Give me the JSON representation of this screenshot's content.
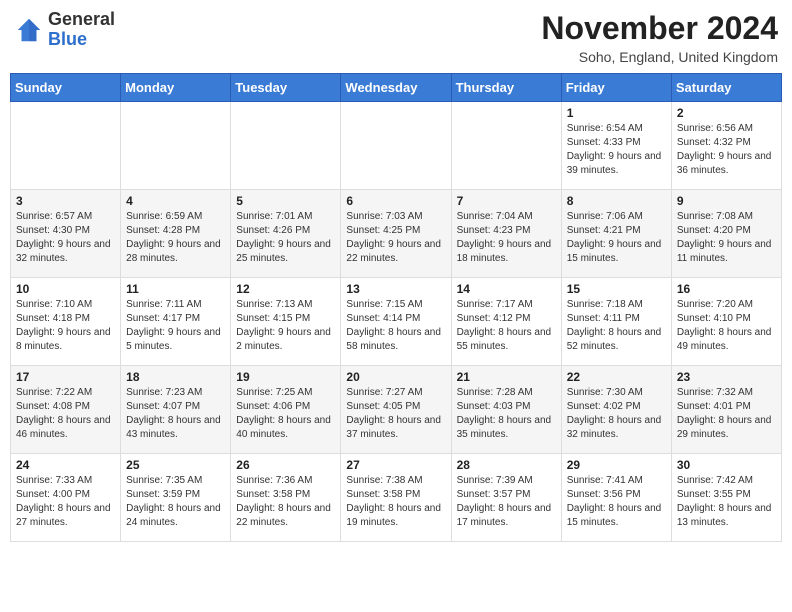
{
  "header": {
    "logo": {
      "general": "General",
      "blue": "Blue"
    },
    "title": "November 2024",
    "location": "Soho, England, United Kingdom"
  },
  "days_of_week": [
    "Sunday",
    "Monday",
    "Tuesday",
    "Wednesday",
    "Thursday",
    "Friday",
    "Saturday"
  ],
  "weeks": [
    [
      {
        "day": "",
        "detail": ""
      },
      {
        "day": "",
        "detail": ""
      },
      {
        "day": "",
        "detail": ""
      },
      {
        "day": "",
        "detail": ""
      },
      {
        "day": "",
        "detail": ""
      },
      {
        "day": "1",
        "detail": "Sunrise: 6:54 AM\nSunset: 4:33 PM\nDaylight: 9 hours and 39 minutes."
      },
      {
        "day": "2",
        "detail": "Sunrise: 6:56 AM\nSunset: 4:32 PM\nDaylight: 9 hours and 36 minutes."
      }
    ],
    [
      {
        "day": "3",
        "detail": "Sunrise: 6:57 AM\nSunset: 4:30 PM\nDaylight: 9 hours and 32 minutes."
      },
      {
        "day": "4",
        "detail": "Sunrise: 6:59 AM\nSunset: 4:28 PM\nDaylight: 9 hours and 28 minutes."
      },
      {
        "day": "5",
        "detail": "Sunrise: 7:01 AM\nSunset: 4:26 PM\nDaylight: 9 hours and 25 minutes."
      },
      {
        "day": "6",
        "detail": "Sunrise: 7:03 AM\nSunset: 4:25 PM\nDaylight: 9 hours and 22 minutes."
      },
      {
        "day": "7",
        "detail": "Sunrise: 7:04 AM\nSunset: 4:23 PM\nDaylight: 9 hours and 18 minutes."
      },
      {
        "day": "8",
        "detail": "Sunrise: 7:06 AM\nSunset: 4:21 PM\nDaylight: 9 hours and 15 minutes."
      },
      {
        "day": "9",
        "detail": "Sunrise: 7:08 AM\nSunset: 4:20 PM\nDaylight: 9 hours and 11 minutes."
      }
    ],
    [
      {
        "day": "10",
        "detail": "Sunrise: 7:10 AM\nSunset: 4:18 PM\nDaylight: 9 hours and 8 minutes."
      },
      {
        "day": "11",
        "detail": "Sunrise: 7:11 AM\nSunset: 4:17 PM\nDaylight: 9 hours and 5 minutes."
      },
      {
        "day": "12",
        "detail": "Sunrise: 7:13 AM\nSunset: 4:15 PM\nDaylight: 9 hours and 2 minutes."
      },
      {
        "day": "13",
        "detail": "Sunrise: 7:15 AM\nSunset: 4:14 PM\nDaylight: 8 hours and 58 minutes."
      },
      {
        "day": "14",
        "detail": "Sunrise: 7:17 AM\nSunset: 4:12 PM\nDaylight: 8 hours and 55 minutes."
      },
      {
        "day": "15",
        "detail": "Sunrise: 7:18 AM\nSunset: 4:11 PM\nDaylight: 8 hours and 52 minutes."
      },
      {
        "day": "16",
        "detail": "Sunrise: 7:20 AM\nSunset: 4:10 PM\nDaylight: 8 hours and 49 minutes."
      }
    ],
    [
      {
        "day": "17",
        "detail": "Sunrise: 7:22 AM\nSunset: 4:08 PM\nDaylight: 8 hours and 46 minutes."
      },
      {
        "day": "18",
        "detail": "Sunrise: 7:23 AM\nSunset: 4:07 PM\nDaylight: 8 hours and 43 minutes."
      },
      {
        "day": "19",
        "detail": "Sunrise: 7:25 AM\nSunset: 4:06 PM\nDaylight: 8 hours and 40 minutes."
      },
      {
        "day": "20",
        "detail": "Sunrise: 7:27 AM\nSunset: 4:05 PM\nDaylight: 8 hours and 37 minutes."
      },
      {
        "day": "21",
        "detail": "Sunrise: 7:28 AM\nSunset: 4:03 PM\nDaylight: 8 hours and 35 minutes."
      },
      {
        "day": "22",
        "detail": "Sunrise: 7:30 AM\nSunset: 4:02 PM\nDaylight: 8 hours and 32 minutes."
      },
      {
        "day": "23",
        "detail": "Sunrise: 7:32 AM\nSunset: 4:01 PM\nDaylight: 8 hours and 29 minutes."
      }
    ],
    [
      {
        "day": "24",
        "detail": "Sunrise: 7:33 AM\nSunset: 4:00 PM\nDaylight: 8 hours and 27 minutes."
      },
      {
        "day": "25",
        "detail": "Sunrise: 7:35 AM\nSunset: 3:59 PM\nDaylight: 8 hours and 24 minutes."
      },
      {
        "day": "26",
        "detail": "Sunrise: 7:36 AM\nSunset: 3:58 PM\nDaylight: 8 hours and 22 minutes."
      },
      {
        "day": "27",
        "detail": "Sunrise: 7:38 AM\nSunset: 3:58 PM\nDaylight: 8 hours and 19 minutes."
      },
      {
        "day": "28",
        "detail": "Sunrise: 7:39 AM\nSunset: 3:57 PM\nDaylight: 8 hours and 17 minutes."
      },
      {
        "day": "29",
        "detail": "Sunrise: 7:41 AM\nSunset: 3:56 PM\nDaylight: 8 hours and 15 minutes."
      },
      {
        "day": "30",
        "detail": "Sunrise: 7:42 AM\nSunset: 3:55 PM\nDaylight: 8 hours and 13 minutes."
      }
    ]
  ]
}
